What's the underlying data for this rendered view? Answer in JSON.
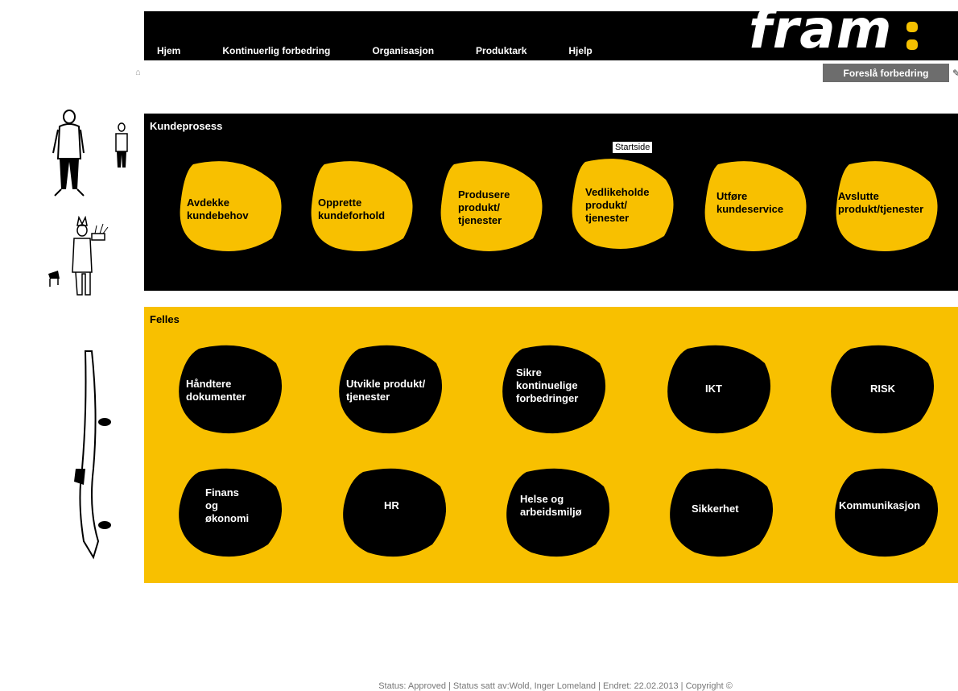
{
  "header": {
    "logo_text": "fram",
    "nav": [
      "Hjem",
      "Kontinuerlig forbedring",
      "Organisasjon",
      "Produktark",
      "Hjelp"
    ],
    "suggest_button": "Foreslå forbedring"
  },
  "kundeprosess": {
    "title": "Kundeprosess",
    "tooltip": "Startside",
    "items": [
      "Avdekke\nkundebehov",
      "Opprette\nkundeforhold",
      "Produsere\nprodukt/\ntjenester",
      "Vedlikeholde\nprodukt/\ntjenester",
      "Utføre\nkundeservice",
      "Avslutte\nprodukt/tjenester"
    ]
  },
  "felles": {
    "title": "Felles",
    "row1": [
      "Håndtere\ndokumenter",
      "Utvikle produkt/\ntjenester",
      "Sikre\nkontinuelige\nforbedringer",
      "IKT",
      "RISK"
    ],
    "row2": [
      "Finans\nog\nøkonomi",
      "HR",
      "Helse og\narbeidsmiljø",
      "Sikkerhet",
      "Kommunikasjon"
    ]
  },
  "footer": "Status: Approved | Status satt av:Wold, Inger Lomeland | Endret: 22.02.2013 | Copyright ©",
  "colors": {
    "yellow": "#f8c000",
    "black": "#000000",
    "button_gray": "#6d6d6d"
  }
}
